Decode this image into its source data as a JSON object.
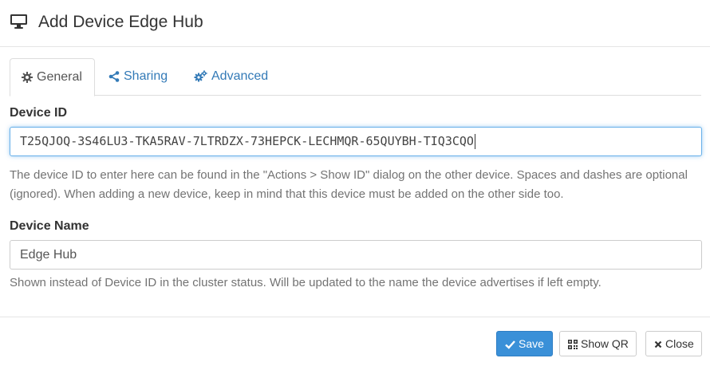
{
  "dialog": {
    "title": "Add Device Edge Hub"
  },
  "tabs": [
    {
      "label": "General",
      "icon": "gear-icon",
      "active": true
    },
    {
      "label": "Sharing",
      "icon": "share-icon",
      "active": false
    },
    {
      "label": "Advanced",
      "icon": "cogs-icon",
      "active": false
    }
  ],
  "device_id": {
    "label": "Device ID",
    "value": "T25QJOQ-3S46LU3-TKA5RAV-7LTRDZX-73HEPCK-LECHMQR-65QUYBH-TIQ3CQO",
    "help": "The device ID to enter here can be found in the \"Actions > Show ID\" dialog on the other device. Spaces and dashes are optional (ignored). When adding a new device, keep in mind that this device must be added on the other side too."
  },
  "device_name": {
    "label": "Device Name",
    "value": "Edge Hub",
    "help": "Shown instead of Device ID in the cluster status. Will be updated to the name the device advertises if left empty."
  },
  "footer": {
    "save_label": "Save",
    "show_qr_label": "Show QR",
    "close_label": "Close"
  },
  "colors": {
    "primary": "#3a90d8",
    "link": "#337ab7",
    "focus": "#66afe9"
  }
}
